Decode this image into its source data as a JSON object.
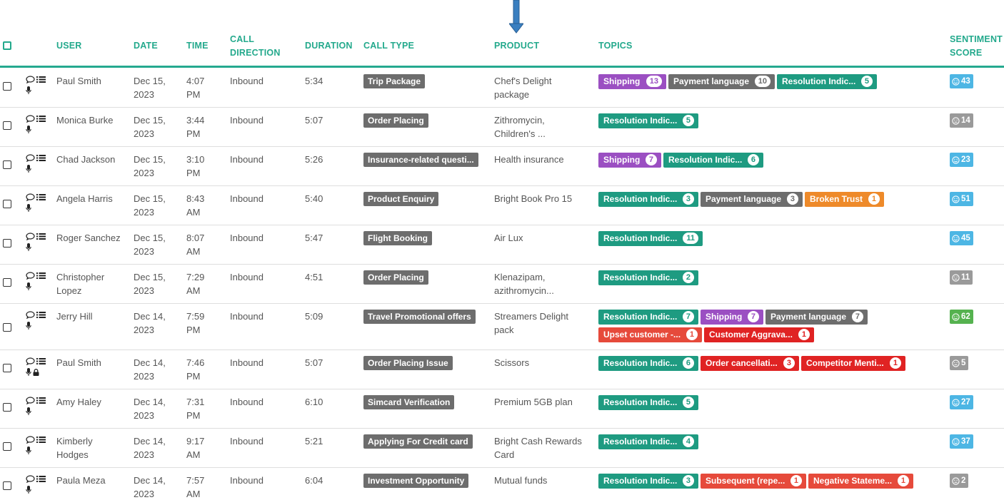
{
  "header": {
    "user": "USER",
    "date": "DATE",
    "time": "TIME",
    "call_direction_1": "CALL",
    "call_direction_2": "DIRECTION",
    "duration": "DURATION",
    "call_type": "CALL TYPE",
    "product": "PRODUCT",
    "topics": "TOPICS",
    "sentiment_1": "SENTIMENT",
    "sentiment_2": "SCORE"
  },
  "colors": {
    "accent": "#23a98c",
    "grey": "#6d6d6d",
    "teal": "#1e9b81",
    "purple": "#9b4fc2",
    "orange": "#ee8a2a",
    "red": "#e02323",
    "coral": "#e64a3b",
    "blue_score": "#4db6e4",
    "grey_score": "#9a9a9a",
    "green_score": "#55b24f",
    "arrow": "#3a7fc0"
  },
  "rows": [
    {
      "user": [
        "Paul Smith"
      ],
      "date": [
        "Dec 15,",
        "2023"
      ],
      "time": [
        "4:07",
        "PM"
      ],
      "direction": "Inbound",
      "duration": "5:34",
      "call_type": "Trip Package",
      "product": [
        "Chef's Delight",
        "package"
      ],
      "lock": false,
      "topics": [
        {
          "label": "Shipping",
          "count": "13",
          "color": "purple"
        },
        {
          "label": "Payment language",
          "count": "10",
          "color": "grey"
        },
        {
          "label": "Resolution Indic...",
          "count": "5",
          "color": "teal"
        }
      ],
      "sentiment": {
        "value": "43",
        "mood": "happy",
        "color": "blue_score"
      }
    },
    {
      "user": [
        "Monica Burke"
      ],
      "date": [
        "Dec 15,",
        "2023"
      ],
      "time": [
        "3:44",
        "PM"
      ],
      "direction": "Inbound",
      "duration": "5:07",
      "call_type": "Order Placing",
      "product": [
        "Zithromycin,",
        "Children's ..."
      ],
      "lock": false,
      "topics": [
        {
          "label": "Resolution Indic...",
          "count": "5",
          "color": "teal"
        }
      ],
      "sentiment": {
        "value": "14",
        "mood": "neutral",
        "color": "grey_score"
      }
    },
    {
      "user": [
        "Chad Jackson"
      ],
      "date": [
        "Dec 15,",
        "2023"
      ],
      "time": [
        "3:10",
        "PM"
      ],
      "direction": "Inbound",
      "duration": "5:26",
      "call_type": "Insurance-related questi...",
      "product": [
        "Health insurance"
      ],
      "lock": false,
      "topics": [
        {
          "label": "Shipping",
          "count": "7",
          "color": "purple"
        },
        {
          "label": "Resolution Indic...",
          "count": "6",
          "color": "teal"
        }
      ],
      "sentiment": {
        "value": "23",
        "mood": "happy",
        "color": "blue_score"
      }
    },
    {
      "user": [
        "Angela Harris"
      ],
      "date": [
        "Dec 15,",
        "2023"
      ],
      "time": [
        "8:43",
        "AM"
      ],
      "direction": "Inbound",
      "duration": "5:40",
      "call_type": "Product Enquiry",
      "product": [
        "Bright Book Pro 15"
      ],
      "lock": false,
      "topics": [
        {
          "label": "Resolution Indic...",
          "count": "3",
          "color": "teal"
        },
        {
          "label": "Payment language",
          "count": "3",
          "color": "grey"
        },
        {
          "label": "Broken Trust",
          "count": "1",
          "color": "orange"
        }
      ],
      "sentiment": {
        "value": "51",
        "mood": "happy",
        "color": "blue_score"
      }
    },
    {
      "user": [
        "Roger Sanchez"
      ],
      "date": [
        "Dec 15,",
        "2023"
      ],
      "time": [
        "8:07",
        "AM"
      ],
      "direction": "Inbound",
      "duration": "5:47",
      "call_type": "Flight Booking",
      "product": [
        "Air Lux"
      ],
      "lock": false,
      "topics": [
        {
          "label": "Resolution Indic...",
          "count": "11",
          "color": "teal"
        }
      ],
      "sentiment": {
        "value": "45",
        "mood": "happy",
        "color": "blue_score"
      }
    },
    {
      "user": [
        "Christopher",
        "Lopez"
      ],
      "date": [
        "Dec 15,",
        "2023"
      ],
      "time": [
        "7:29",
        "AM"
      ],
      "direction": "Inbound",
      "duration": "4:51",
      "call_type": "Order Placing",
      "product": [
        "Klenazipam,",
        "azithromycin..."
      ],
      "lock": false,
      "topics": [
        {
          "label": "Resolution Indic...",
          "count": "2",
          "color": "teal"
        }
      ],
      "sentiment": {
        "value": "11",
        "mood": "neutral",
        "color": "grey_score"
      }
    },
    {
      "user": [
        "Jerry Hill"
      ],
      "date": [
        "Dec 14,",
        "2023"
      ],
      "time": [
        "7:59",
        "PM"
      ],
      "direction": "Inbound",
      "duration": "5:09",
      "call_type": "Travel Promotional offers",
      "product": [
        "Streamers Delight",
        "pack"
      ],
      "lock": false,
      "topics": [
        {
          "label": "Resolution Indic...",
          "count": "7",
          "color": "teal"
        },
        {
          "label": "Shipping",
          "count": "7",
          "color": "purple"
        },
        {
          "label": "Payment language",
          "count": "7",
          "color": "grey"
        },
        {
          "label": "Upset customer -...",
          "count": "1",
          "color": "coral"
        },
        {
          "label": "Customer Aggrava...",
          "count": "1",
          "color": "red"
        }
      ],
      "sentiment": {
        "value": "62",
        "mood": "happy",
        "color": "green_score"
      }
    },
    {
      "user": [
        "Paul Smith"
      ],
      "date": [
        "Dec 14,",
        "2023"
      ],
      "time": [
        "7:46",
        "PM"
      ],
      "direction": "Inbound",
      "duration": "5:07",
      "call_type": "Order Placing Issue",
      "product": [
        "Scissors"
      ],
      "lock": true,
      "topics": [
        {
          "label": "Resolution Indic...",
          "count": "6",
          "color": "teal"
        },
        {
          "label": "Order cancellati...",
          "count": "3",
          "color": "red"
        },
        {
          "label": "Competitor Menti...",
          "count": "1",
          "color": "red"
        }
      ],
      "sentiment": {
        "value": "5",
        "mood": "neutral",
        "color": "grey_score"
      }
    },
    {
      "user": [
        "Amy Haley"
      ],
      "date": [
        "Dec 14,",
        "2023"
      ],
      "time": [
        "7:31",
        "PM"
      ],
      "direction": "Inbound",
      "duration": "6:10",
      "call_type": "Simcard Verification",
      "product": [
        "Premium 5GB plan"
      ],
      "lock": false,
      "topics": [
        {
          "label": "Resolution Indic...",
          "count": "5",
          "color": "teal"
        }
      ],
      "sentiment": {
        "value": "27",
        "mood": "happy",
        "color": "blue_score"
      }
    },
    {
      "user": [
        "Kimberly",
        "Hodges"
      ],
      "date": [
        "Dec 14,",
        "2023"
      ],
      "time": [
        "9:17",
        "AM"
      ],
      "direction": "Inbound",
      "duration": "5:21",
      "call_type": "Applying For Credit card",
      "product": [
        "Bright Cash Rewards",
        "Card"
      ],
      "lock": false,
      "topics": [
        {
          "label": "Resolution Indic...",
          "count": "4",
          "color": "teal"
        }
      ],
      "sentiment": {
        "value": "37",
        "mood": "happy",
        "color": "blue_score"
      }
    },
    {
      "user": [
        "Paula Meza"
      ],
      "date": [
        "Dec 14,",
        "2023"
      ],
      "time": [
        "7:57",
        "AM"
      ],
      "direction": "Inbound",
      "duration": "6:04",
      "call_type": "Investment Opportunity",
      "product": [
        "Mutual funds"
      ],
      "lock": false,
      "topics": [
        {
          "label": "Resolution Indic...",
          "count": "3",
          "color": "teal"
        },
        {
          "label": "Subsequent (repe...",
          "count": "1",
          "color": "coral"
        },
        {
          "label": "Negative Stateme...",
          "count": "1",
          "color": "coral"
        }
      ],
      "sentiment": {
        "value": "2",
        "mood": "neutral",
        "color": "grey_score"
      }
    }
  ]
}
